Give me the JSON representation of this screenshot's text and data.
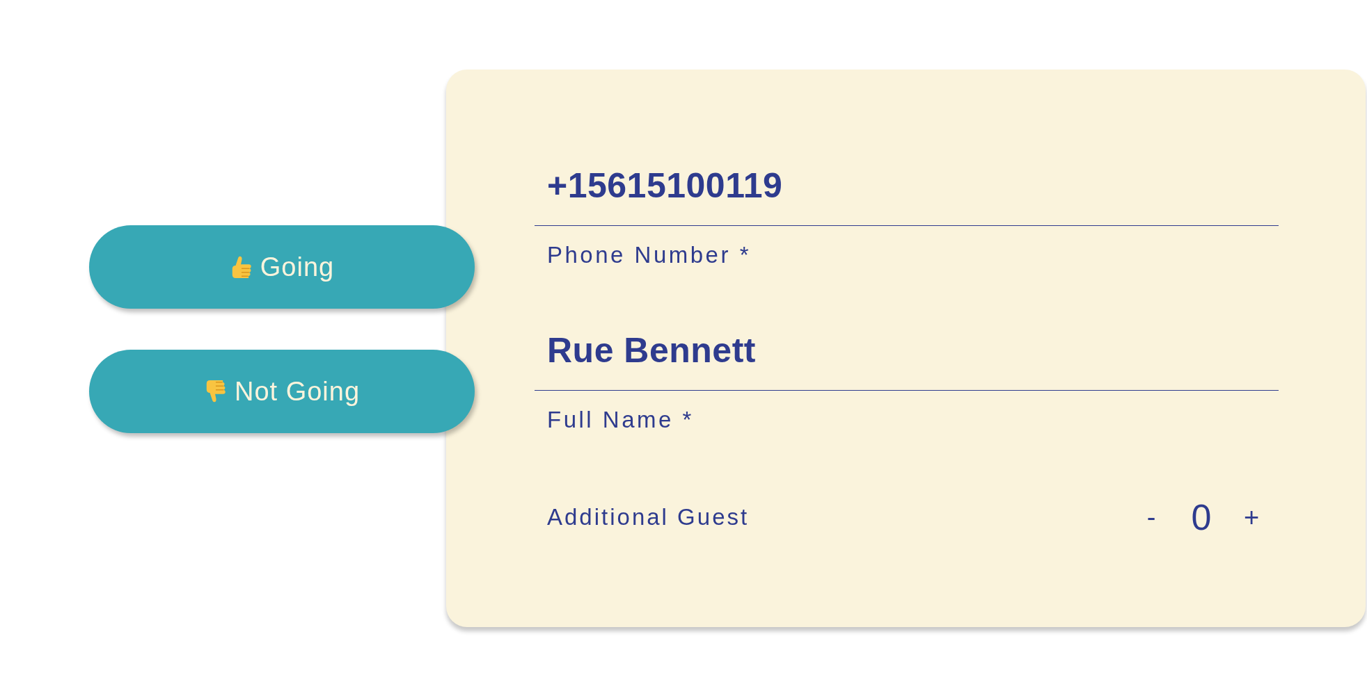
{
  "rsvp_buttons": [
    {
      "label": "Going",
      "kind": "accept"
    },
    {
      "label": "Not Going",
      "kind": "decline"
    }
  ],
  "form": {
    "fields": [
      {
        "value": "+15615100119",
        "label": "Phone Number *"
      },
      {
        "value": "Rue Bennett",
        "label": "Full Name *"
      }
    ],
    "guest_counter": {
      "label": "Additional Guest",
      "decrement": "-",
      "count": "0",
      "increment": "+"
    }
  }
}
